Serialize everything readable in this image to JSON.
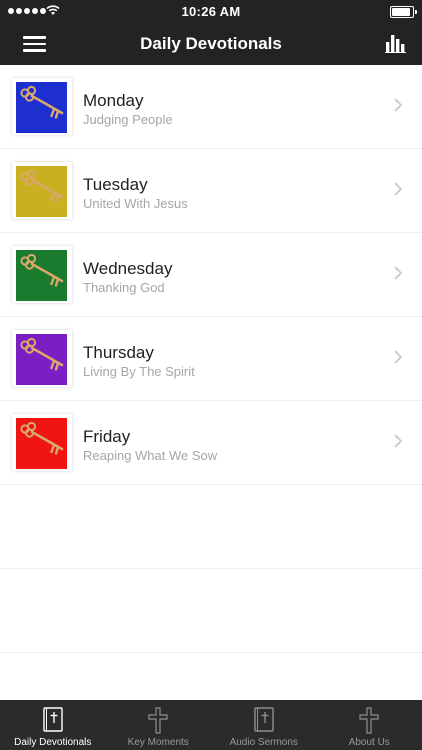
{
  "status_bar": {
    "time": "10:26 AM"
  },
  "nav": {
    "title": "Daily Devotionals"
  },
  "devotionals": [
    {
      "day": "Monday",
      "subtitle": "Judging People",
      "color": "#1e2fd0"
    },
    {
      "day": "Tuesday",
      "subtitle": "United With Jesus",
      "color": "#c8b021"
    },
    {
      "day": "Wednesday",
      "subtitle": "Thanking God",
      "color": "#1a7a2e"
    },
    {
      "day": "Thursday",
      "subtitle": "Living By The Spirit",
      "color": "#7b1fc4"
    },
    {
      "day": "Friday",
      "subtitle": "Reaping What We Sow",
      "color": "#f01414"
    }
  ],
  "tabs": [
    {
      "label": "Daily Devotionals",
      "icon": "bible-icon",
      "active": true
    },
    {
      "label": "Key Moments",
      "icon": "cross-icon",
      "active": false
    },
    {
      "label": "Audio Sermons",
      "icon": "bible-icon",
      "active": false
    },
    {
      "label": "About Us",
      "icon": "cross-icon",
      "active": false
    }
  ],
  "colors": {
    "bar_background": "#232323",
    "tab_background": "#2b2b2b",
    "subtitle_text": "#a6a6a6"
  },
  "icons": {
    "signal": "signal-dots-icon",
    "wifi": "wifi-icon",
    "battery": "battery-icon",
    "menu": "hamburger-menu-icon",
    "stats": "bar-chart-icon",
    "thumbnail": "key-icon",
    "row_action": "chevron-right-icon"
  },
  "battery_level": 1
}
